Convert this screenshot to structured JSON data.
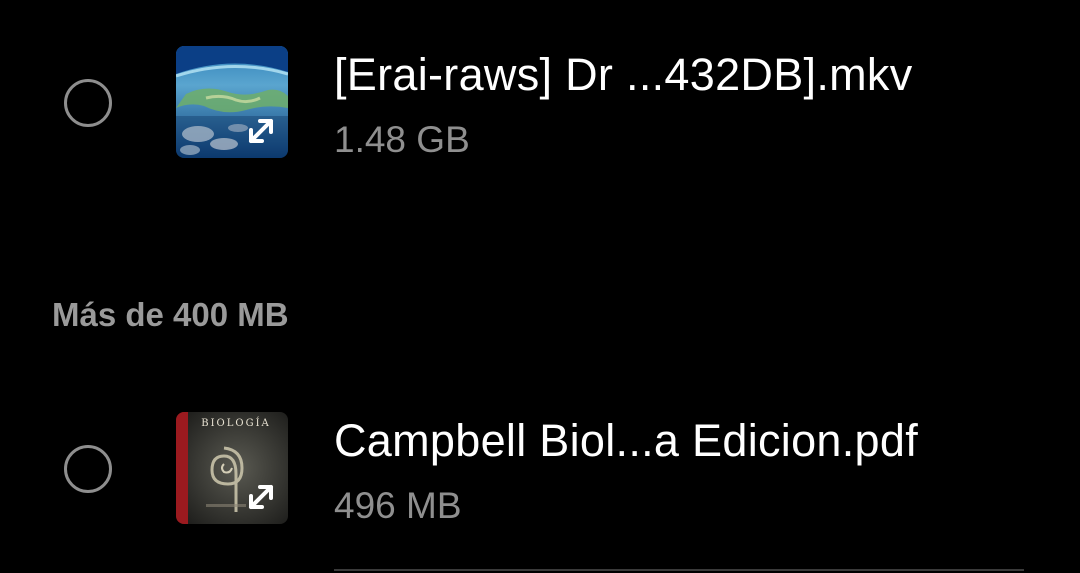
{
  "files_top": [
    {
      "name": "[Erai-raws] Dr ...432DB].mkv",
      "size": "1.48 GB",
      "selected": false,
      "thumbnail": "earth-from-space-icon",
      "badge_icon": "expand-icon"
    }
  ],
  "section": {
    "header": "Más de 400 MB"
  },
  "files_section": [
    {
      "name": "Campbell Biol...a Edicion.pdf",
      "size": "496 MB",
      "selected": false,
      "thumbnail": "book-cover-icon",
      "cover_title": "BIOLOGÍA",
      "badge_icon": "expand-icon"
    }
  ],
  "colors": {
    "background": "#000000",
    "primary_text": "#ffffff",
    "secondary_text": "#8f8f8f",
    "radio_border": "#8e8e8e"
  }
}
